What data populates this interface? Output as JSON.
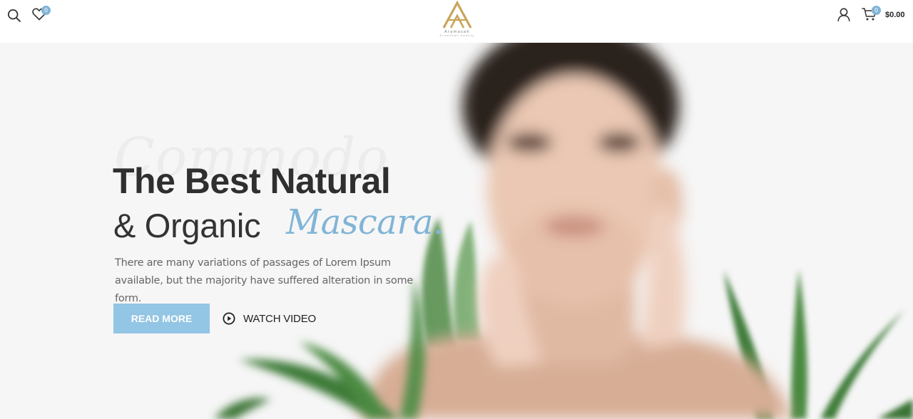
{
  "header": {
    "search_icon": "search-icon",
    "wishlist": {
      "icon": "heart-icon",
      "count": "0"
    },
    "logo": {
      "name": "Aramasah",
      "tagline": "Aramasah beauty"
    },
    "account_icon": "user-icon",
    "cart": {
      "icon": "cart-icon",
      "count": "0",
      "total": "$0.00"
    }
  },
  "hero": {
    "watermark": "Commodo",
    "headline_line1": "The Best Natural",
    "headline_line2": "& Organic",
    "headline_script": "Mascara.",
    "description": "There are many variations of passages of Lorem Ipsum available, but the majority have suffered alteration in some form.",
    "read_more_label": "READ MORE",
    "watch_video_label": "WATCH VIDEO"
  },
  "colors": {
    "accent": "#80b4d6",
    "button": "#93c5e4",
    "logo_gold": "#c9a55a",
    "hero_bg": "#f6f6f6",
    "text_dark": "#2f2f2f"
  }
}
